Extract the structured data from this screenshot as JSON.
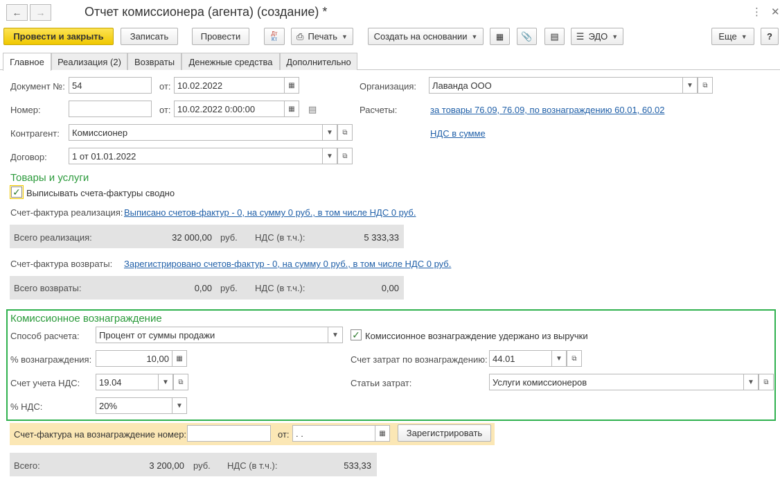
{
  "window": {
    "title": "Отчет комиссионера (агента) (создание) *",
    "nav_back_icon": "arrow-left-icon",
    "nav_forward_icon": "arrow-right-icon"
  },
  "toolbar": {
    "post_close": "Провести и закрыть",
    "save": "Записать",
    "post": "Провести",
    "dt_kt": "Дт Кт",
    "print": "Печать",
    "create_based_on": "Создать на основании",
    "edo": "ЭДО",
    "more": "Еще",
    "help": "?"
  },
  "tabs": [
    {
      "label": "Главное"
    },
    {
      "label": "Реализация (2)"
    },
    {
      "label": "Возвраты"
    },
    {
      "label": "Денежные средства"
    },
    {
      "label": "Дополнительно"
    }
  ],
  "header": {
    "doc_no_label": "Документ №:",
    "doc_no": "54",
    "from_label": "от:",
    "doc_date": "10.02.2022",
    "number_label": "Номер:",
    "number_value": "",
    "number_date": "10.02.2022  0:00:00",
    "contractor_label": "Контрагент:",
    "contractor": "Комиссионер",
    "contract_label": "Договор:",
    "contract": "1 от 01.01.2022",
    "org_label": "Организация:",
    "org": "Лаванда ООО",
    "settlements_label": "Расчеты:",
    "settlements_link": "за товары 76.09, 76.09, по вознаграждению 60.01, 60.02",
    "vat_link": "НДС в сумме"
  },
  "goods": {
    "section_title": "Товары и услуги",
    "invoice_summary_label": "Выписывать счета-фактуры сводно",
    "invoice_summary_checked": true,
    "sales_invoice_label": "Счет-фактура реализация:",
    "sales_invoice_link": "Выписано счетов-фактур - 0, на сумму 0 руб., в том числе НДС 0 руб.",
    "total_sales_label": "Всего реализация:",
    "total_sales": "32 000,00",
    "currency": "руб.",
    "vat_incl_label": "НДС (в т.ч.):",
    "total_sales_vat": "5 333,33",
    "returns_invoice_label": "Счет-фактура возвраты:",
    "returns_invoice_link": "Зарегистрировано счетов-фактур - 0, на сумму 0 руб., в том числе НДС 0 руб.",
    "total_returns_label": "Всего возвраты:",
    "total_returns": "0,00",
    "total_returns_vat": "0,00"
  },
  "commission": {
    "section_title": "Комиссионное вознаграждение",
    "method_label": "Способ расчета:",
    "method": "Процент от суммы продажи",
    "withheld_label": "Комиссионное вознаграждение удержано из выручки",
    "withheld_checked": true,
    "percent_label": "% вознаграждения:",
    "percent": "10,00",
    "cost_account_label": "Счет затрат по вознаграждению:",
    "cost_account": "44.01",
    "vat_account_label": "Счет учета НДС:",
    "vat_account": "19.04",
    "cost_items_label": "Статьи затрат:",
    "cost_items": "Услуги комиссионеров",
    "vat_rate_label": "% НДС:",
    "vat_rate": "20%"
  },
  "reward_invoice": {
    "label": "Счет-фактура на вознаграждение номер:",
    "number": "",
    "from_label": "от:",
    "date": " .  .",
    "register_button": "Зарегистрировать"
  },
  "totals": {
    "total_label": "Всего:",
    "total": "3 200,00",
    "currency": "руб.",
    "vat_label": "НДС (в т.ч.):",
    "vat": "533,33"
  },
  "colors": {
    "accent_yellow": "#f0c800",
    "section_green": "#2b9a3b",
    "frame_green": "#2fb14e",
    "link_blue": "#1f5fa8",
    "invoice_bar": "#fbe7b5"
  }
}
